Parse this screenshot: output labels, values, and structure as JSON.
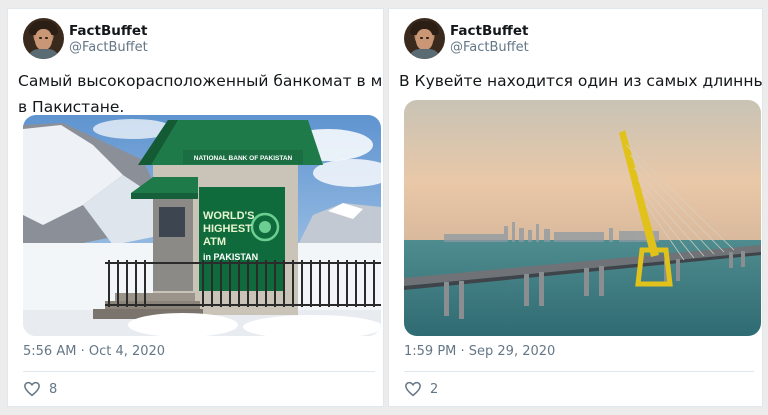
{
  "tweets": [
    {
      "user": {
        "name": "FactBuffet",
        "handle": "@FactBuffet"
      },
      "text_line1": "Самый высокорасположенный банкомат в мире",
      "text_line2": "в Пакистане.",
      "image": {
        "sign_top": "NATIONAL BANK OF PAKISTAN",
        "sign_line1": "WORLD'S",
        "sign_line2": "HIGHEST",
        "sign_line3": "ATM",
        "sign_line4": "in PAKISTAN"
      },
      "timestamp": "5:56 AM · Oct 4, 2020",
      "likes": "8"
    },
    {
      "user": {
        "name": "FactBuffet",
        "handle": "@FactBuffet"
      },
      "text_line1": "В Кувейте находится один из самых длинных",
      "timestamp": "1:59 PM · Sep 29, 2020",
      "likes": "2"
    }
  ],
  "colors": {
    "secondary_text": "#657786",
    "primary_text": "#14171a",
    "card_bg": "#ffffff"
  },
  "icons": [
    "avatar",
    "heart-icon"
  ]
}
